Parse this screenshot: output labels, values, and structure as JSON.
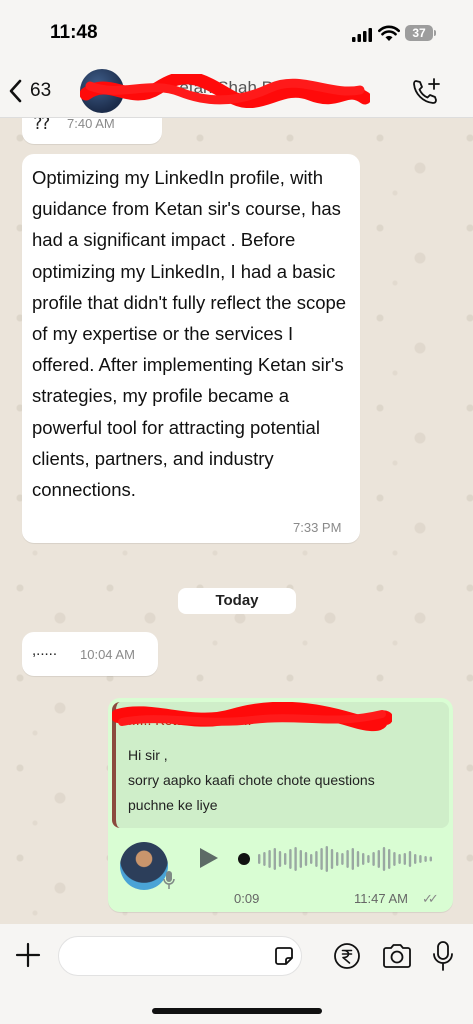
{
  "status_bar": {
    "time": "11:48",
    "battery": "37"
  },
  "header": {
    "back_count": "63",
    "contact_name": "...... Ketan Shah P..."
  },
  "messages": [
    {
      "text": "⁇",
      "time": "7:40 AM"
    },
    {
      "text": "Optimizing my LinkedIn profile, with guidance from Ketan sir's course, has had a significant impact . Before optimizing my LinkedIn, I had a basic profile that didn't fully reflect the scope of my expertise or the services I offered. After implementing Ketan sir's strategies, my profile became a powerful tool for attracting potential clients, partners, and industry connections.",
      "time": "7:33 PM"
    },
    {
      "text": ",.....",
      "time": "10:04 AM"
    }
  ],
  "day_separator": "Today",
  "reply": {
    "author": "...... Ketan Shah P...",
    "line1": "Hi sir ,",
    "line2": "sorry aapko kaafi chote chote questions",
    "line3": "puchne ke liye"
  },
  "voice_note": {
    "duration": "0:09",
    "time": "11:47 AM",
    "ticks": "✓✓"
  },
  "input": {
    "placeholder": ""
  },
  "colors": {
    "outgoing_bubble": "#d9fdd3",
    "incoming_bubble": "#ffffff",
    "chat_wallpaper": "#ebe4da",
    "redaction": "#ff0a0a"
  }
}
